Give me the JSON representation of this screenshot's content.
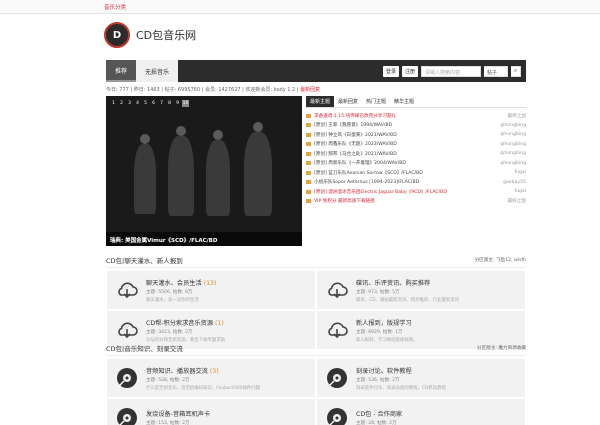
{
  "topbar": {
    "link": "音乐分类"
  },
  "logo": {
    "mark": "D",
    "text": "CD包音乐网"
  },
  "nav": {
    "tabs": [
      "推荐",
      "无损音乐"
    ],
    "login": "登录",
    "register": "注册",
    "search_placeholder": "请输入搜索内容",
    "search_select": "帖子"
  },
  "stats": {
    "today_label": "今日:",
    "today": "777",
    "yesterday_label": "昨日:",
    "yesterday": "1463",
    "posts_label": "帖子:",
    "posts": "6995760",
    "members_label": "会员:",
    "members": "1427627",
    "welcome_label": "欢迎新会员:",
    "welcome": "kody 1 2",
    "latest": "最新回复"
  },
  "slider": {
    "numbers": [
      "1",
      "2",
      "3",
      "4",
      "5",
      "6",
      "7",
      "8",
      "9",
      "10"
    ],
    "caption": "瑞典: 美国金属Vimur《SCD》/FLAC/BD"
  },
  "threads": {
    "tabs": [
      "最新主题",
      "最新回复",
      "热门主题",
      "精华主题"
    ],
    "items": [
      {
        "title": "求备道谱:1.15.块传媒已改完分享习题礼",
        "author": "最终之战",
        "hot": true
      },
      {
        "title": "[原创] 王菲《我愿意》1994/WAV/BD",
        "author": "qihongbing",
        "hot": false
      },
      {
        "title": "[原创] 钟立风《白蛋黄》2021/WAV/BD",
        "author": "qihongbing",
        "hot": false
      },
      {
        "title": "[原创] 周鑫乐队《无题》2023/WAV/BD",
        "author": "qihongbing",
        "hot": false
      },
      {
        "title": "[原创] 郝邦《马合之处》2021/WAV/BD",
        "author": "qihongbing",
        "hot": false
      },
      {
        "title": "[原创] 周新乐队《一开着理》2004/WAV/BD",
        "author": "qihongbing",
        "hot": false
      },
      {
        "title": "[原创] 蓝刀乐队Aeonian Sorrow《SCD》/FLAC/BD",
        "author": "fugal",
        "hot": false
      },
      {
        "title": "小组乐队Sopor Aeternus [1994-2023]/FLAC/BD",
        "author": "gaebay55",
        "hot": false
      },
      {
        "title": "[原创] 澳洲溜冰音乐团Electric Jaguar Baby《9CD》/FLAC/BD",
        "author": "fugal",
        "hot": true
      },
      {
        "title": "VIP 免积分 最新高速下载链接",
        "author": "最好之窗",
        "hot": true
      }
    ]
  },
  "sections": [
    {
      "title": "CD包|聊天灌水、新人报到",
      "mod": "分区版主: 飞鱼12, wlsfh",
      "forums": [
        {
          "name": "聊天灌水、会员生活",
          "count": "(13)",
          "meta": "主题: 5506, 帖数: 8万",
          "desc": "聊天灌水，谈一谈你的生活",
          "icon": "cloud-icon"
        },
        {
          "name": "碟讯、乐评资讯、购买推荐",
          "count": "",
          "meta": "主题: 973, 帖数: 5万",
          "desc": "碟讯、CD、碟帖最新资讯、购买推荐、行业最新资讯",
          "icon": "cloud-icon"
        },
        {
          "name": "CD帮-积分索求音乐资源",
          "count": "(1)",
          "meta": "主题: 3423, 帖数: 2万",
          "desc": "论坛积分和无损资源，要出下载专题求助",
          "icon": "cloud-icon"
        },
        {
          "name": "新人报到，版规学习",
          "count": "",
          "meta": "主题: 6929, 帖数: 1万",
          "desc": "新人报到、学习网站版规规则。",
          "icon": "cloud-icon"
        }
      ]
    },
    {
      "title": "CD包|音乐知识、刻录交流",
      "mod": "分区版主: 魔力资源收藏",
      "forums": [
        {
          "name": "音频知识、播放器交流",
          "count": "(3)",
          "meta": "主题: 528, 帖数: 2万",
          "desc": "什么是无损音乐，音无损编码知识，Foobar2000插件问题",
          "icon": "disc-icon"
        },
        {
          "name": "刻录讨论、软件教程",
          "count": "",
          "meta": "主题: 536, 帖数: 2万",
          "desc": "刻录软件讨论、刻录光盘的教程，CD抓轨教程",
          "icon": "disc-icon"
        },
        {
          "name": "发烧设备-音箱耳机声卡",
          "count": "",
          "meta": "主题: 153, 帖数: 2万",
          "desc": "",
          "icon": "disc-icon"
        },
        {
          "name": "CD包 - 合作商家",
          "count": "",
          "meta": "主题: 28, 帖数: 2万",
          "desc": "",
          "icon": "disc-icon"
        }
      ]
    }
  ],
  "colors": {
    "accent": "#d22233",
    "nav_bg": "#2c2c2c",
    "forum_bg": "#f2f2f2",
    "count": "#d98c2b"
  }
}
